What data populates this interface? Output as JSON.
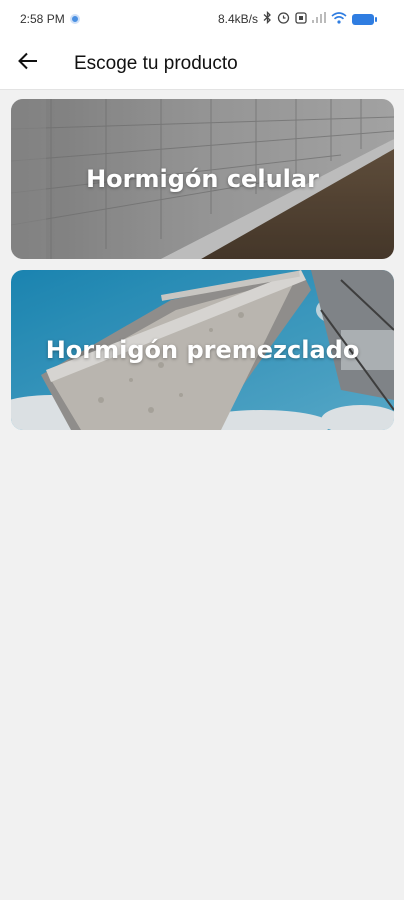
{
  "status_bar": {
    "time": "2:58 PM",
    "network_speed": "8.4kB/s",
    "icons": [
      "location-dot-icon",
      "bluetooth-icon",
      "alarm-icon",
      "nfc-icon",
      "signal-icon",
      "wifi-icon",
      "battery-icon"
    ]
  },
  "app_bar": {
    "back_icon": "arrow-left-icon",
    "title": "Escoge tu producto"
  },
  "products": [
    {
      "label": "Hormigón celular",
      "image": "concrete-block-wall-photo"
    },
    {
      "label": "Hormigón premezclado",
      "image": "concrete-chute-pour-photo"
    }
  ],
  "colors": {
    "background": "#f1f1f1",
    "app_bar": "#ffffff",
    "card_text": "#ffffff",
    "status_accent": "#2f7de1"
  }
}
